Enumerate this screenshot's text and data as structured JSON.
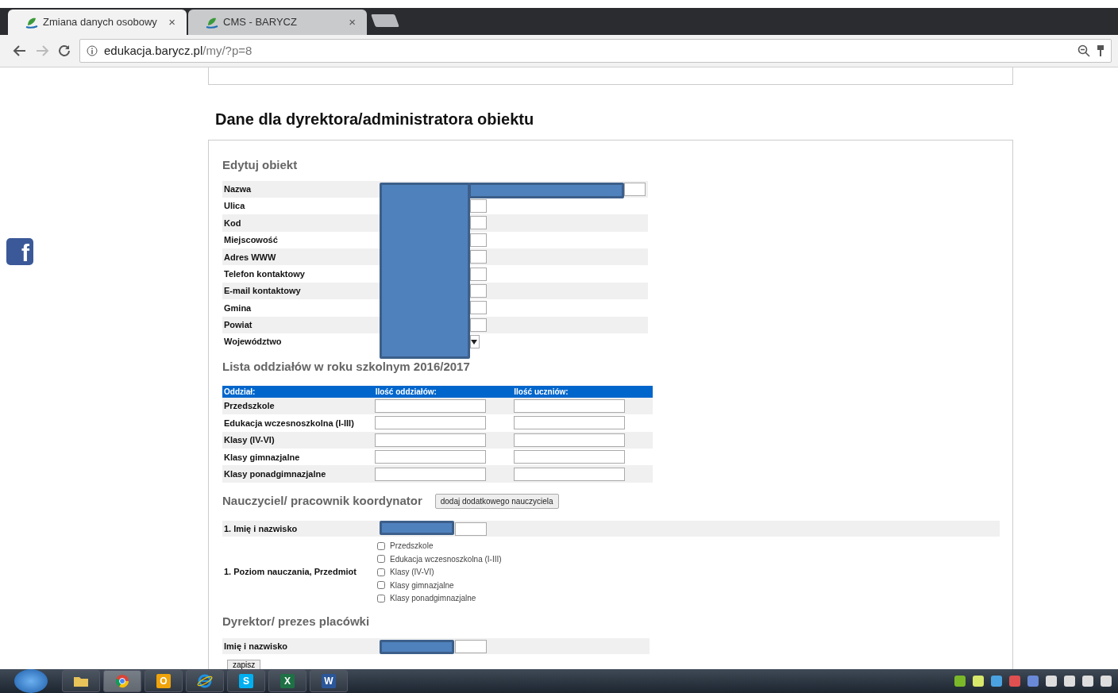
{
  "browser": {
    "tabs": [
      {
        "title": "Zmiana danych osobowy",
        "close": "×",
        "selected": true
      },
      {
        "title": "CMS - BARYCZ",
        "close": "×",
        "selected": false
      }
    ],
    "address": {
      "host": "edukacja.barycz.pl",
      "path": "/my/?p=8"
    }
  },
  "social": {
    "glyph": "f"
  },
  "page": {
    "heading": "Dane dla dyrektora/administratora obiektu",
    "edit_section": {
      "title": "Edytuj obiekt",
      "fields": [
        {
          "label": "Nazwa",
          "kind": "wide"
        },
        {
          "label": "Ulica",
          "kind": "text"
        },
        {
          "label": "Kod",
          "kind": "text"
        },
        {
          "label": "Miejscowość",
          "kind": "text"
        },
        {
          "label": "Adres WWW",
          "kind": "text"
        },
        {
          "label": "Telefon kontaktowy",
          "kind": "text"
        },
        {
          "label": "E-mail kontaktowy",
          "kind": "text"
        },
        {
          "label": "Gmina",
          "kind": "text"
        },
        {
          "label": "Powiat",
          "kind": "text"
        },
        {
          "label": "Województwo",
          "kind": "select"
        }
      ]
    },
    "classes": {
      "title": "Lista oddziałów w roku szkolnym 2016/2017",
      "columns": [
        "Oddział:",
        "Ilość oddziałów:",
        "Ilość uczniów:"
      ],
      "rows": [
        "Przedszkole",
        "Edukacja wczesnoszkolna (I-III)",
        "Klasy (IV-VI)",
        "Klasy gimnazjalne",
        "Klasy ponadgimnazjalne"
      ]
    },
    "teacher": {
      "title": "Nauczyciel/ pracownik koordynator",
      "add_button": "dodaj dodatkowego nauczyciela",
      "name_label": "1. Imię i nazwisko",
      "level_label": "1. Poziom nauczania, Przedmiot",
      "levels": [
        {
          "label": "Przedszkole",
          "checked": false
        },
        {
          "label": "Edukacja wczesnoszkolna (I-III)",
          "checked": false
        },
        {
          "label": "Klasy (IV-VI)",
          "checked": false
        },
        {
          "label": "Klasy gimnazjalne",
          "checked": false
        },
        {
          "label": "Klasy ponadgimnazjalne",
          "checked": false
        }
      ]
    },
    "director": {
      "title": "Dyrektor/ prezes placówki",
      "name_label": "Imię i nazwisko"
    },
    "save_button": "zapisz"
  },
  "taskbar": {
    "apps": [
      {
        "kind": "folder",
        "selected": false
      },
      {
        "kind": "chrome",
        "selected": true
      },
      {
        "kind": "letter",
        "glyph": "O",
        "color": "#f0a30a",
        "selected": false
      },
      {
        "kind": "ie",
        "selected": false
      },
      {
        "kind": "letter",
        "glyph": "S",
        "color": "#00aff0",
        "selected": false
      },
      {
        "kind": "letter",
        "glyph": "X",
        "color": "#1e7145",
        "selected": false
      },
      {
        "kind": "letter",
        "glyph": "W",
        "color": "#2b579a",
        "selected": false
      }
    ]
  }
}
